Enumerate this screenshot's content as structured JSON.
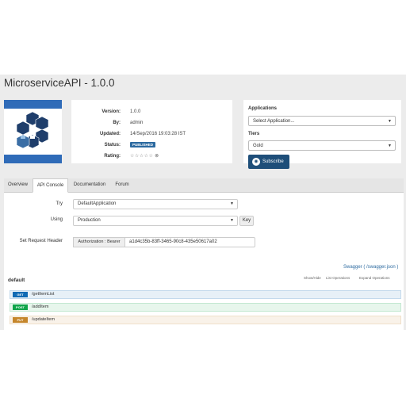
{
  "header": {
    "title": "MicroserviceAPI - 1.0.0"
  },
  "info": {
    "version_label": "Version:",
    "version": "1.0.0",
    "by_label": "By:",
    "by": "admin",
    "updated_label": "Updated:",
    "updated": "14/Sep/2016 19:03:28 IST",
    "status_label": "Status:",
    "status": "PUBLISHED",
    "rating_label": "Rating:",
    "rating_stars": "☆☆☆☆☆",
    "rating_icon": "⊗"
  },
  "subscription": {
    "applications_label": "Applications",
    "application_selected": "Select Application...",
    "tiers_label": "Tiers",
    "tier_selected": "Gold",
    "subscribe_label": "Subscribe",
    "subscribe_icon": "bell-icon"
  },
  "tabs": [
    {
      "label": "Overview"
    },
    {
      "label": "API Console"
    },
    {
      "label": "Documentation"
    },
    {
      "label": "Forum"
    }
  ],
  "console": {
    "try_label": "Try",
    "try_value": "DefaultApplication",
    "using_label": "Using",
    "using_value": "Production",
    "key_label": "Key",
    "header_label": "Set Request Header",
    "auth_addon": "Authorization : Bearer",
    "auth_value": "a1d4c35b-83ff-3465-90c8-435e50617a02"
  },
  "swagger": {
    "link_text": "Swagger ( /swagger.json )",
    "group": "default",
    "show_hide": "Show/Hide",
    "list_ops": "List Operations",
    "expand_ops": "Expand Operations",
    "operations": [
      {
        "method": "GET",
        "path": "/getItemList",
        "color": "#0f6ab4",
        "bg": "#e7f0f7",
        "border": "#c3d9ec"
      },
      {
        "method": "POST",
        "path": "/addItem",
        "color": "#10a54a",
        "bg": "#e7f6ec",
        "border": "#c3e8d1"
      },
      {
        "method": "PUT",
        "path": "/updateItem",
        "color": "#c5862b",
        "bg": "#f9f2e9",
        "border": "#f0e0ca"
      }
    ]
  },
  "colors": {
    "accent": "#1e4e79",
    "published": "#2c6aa0"
  }
}
